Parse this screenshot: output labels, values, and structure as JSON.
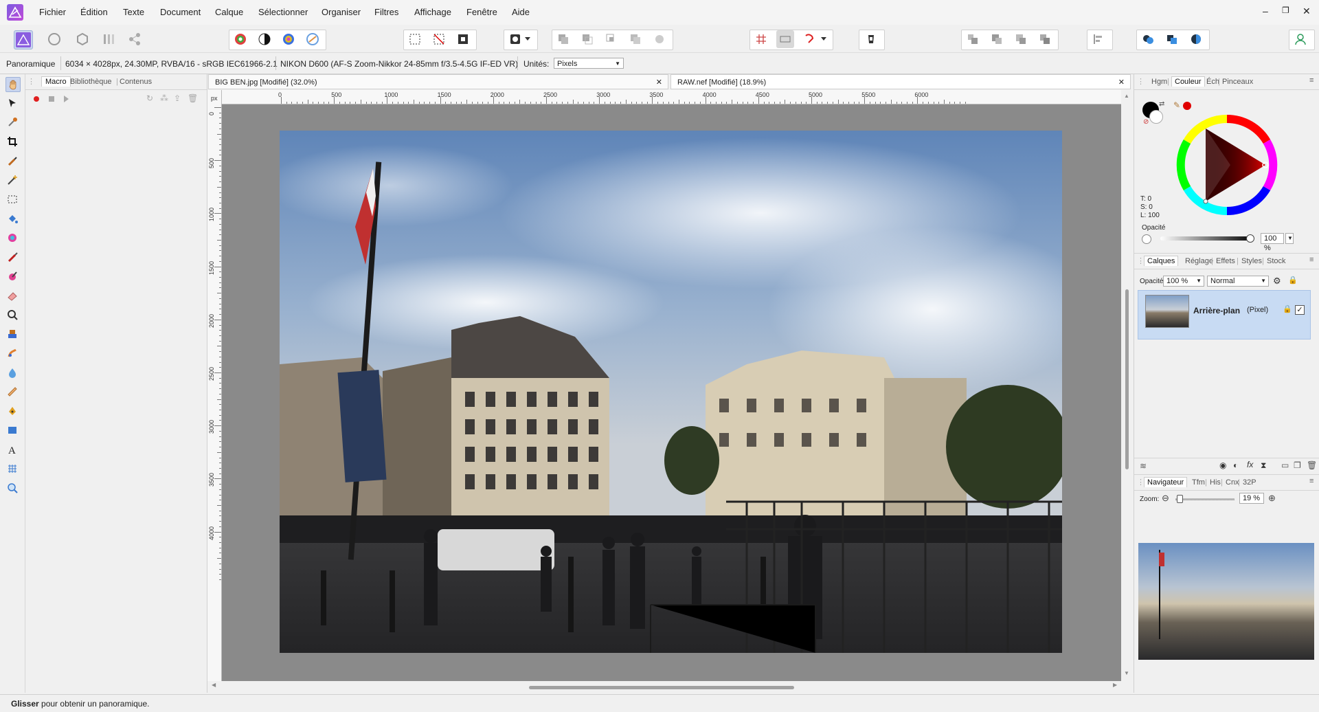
{
  "menubar": {
    "items": [
      "Fichier",
      "Édition",
      "Texte",
      "Document",
      "Calque",
      "Sélectionner",
      "Organiser",
      "Filtres",
      "Affichage",
      "Fenêtre",
      "Aide"
    ],
    "window_controls": [
      "–",
      "❐",
      "✕"
    ]
  },
  "contextbar": {
    "mode": "Panoramique",
    "image_info": "6034 × 4028px, 24.30MP, RVBA/16 - sRGB IEC61966-2.1",
    "camera_info": "NIKON D600 (AF-S Zoom-Nikkor 24-85mm f/3.5-4.5G IF-ED VR)",
    "units_label": "Unités:",
    "units_value": "Pixels"
  },
  "left_panel": {
    "tabs": [
      "Macro",
      "Bibliothèque",
      "Contenus"
    ],
    "active_tab": "Macro"
  },
  "documents": {
    "tabs": [
      {
        "label": "BIG BEN.jpg [Modifié] (32.0%)",
        "close": "✕"
      },
      {
        "label": "RAW.nef [Modifié] (18.9%)",
        "close": "✕"
      }
    ]
  },
  "rulers": {
    "unit": "px",
    "top_labels": [
      "0",
      "500",
      "1000",
      "1500",
      "2000",
      "2500",
      "3000",
      "3500",
      "4000",
      "4500",
      "5000",
      "5500",
      "6000"
    ],
    "left_labels": [
      "0",
      "500",
      "1000",
      "1500",
      "2000",
      "2500",
      "3000",
      "3500",
      "4000"
    ]
  },
  "color_panel": {
    "tabs": [
      "Hgm",
      "Couleur",
      "Éch",
      "Pinceaux"
    ],
    "active_tab": "Couleur",
    "t": "T: 0",
    "s": "S: 0",
    "l": "L: 100",
    "opacity_label": "Opacité",
    "opacity_value": "100 %",
    "primary_color": "#000000",
    "secondary_color": "#ffffff",
    "picker_dot": "#e00000"
  },
  "layers_panel": {
    "tabs": [
      "Calques",
      "Réglage",
      "Effets",
      "Styles",
      "Stock"
    ],
    "active_tab": "Calques",
    "opacity_label": "Opacité:",
    "opacity_value": "100 %",
    "blend_mode": "Normal",
    "layer_name": "Arrière-plan",
    "layer_type": "(Pixel)"
  },
  "navigator_panel": {
    "tabs": [
      "Navigateur",
      "Tfm",
      "His",
      "Cnx",
      "32P"
    ],
    "active_tab": "Navigateur",
    "zoom_label": "Zoom:",
    "zoom_value": "19 %"
  },
  "status": {
    "bold": "Glisser",
    "text": " pour obtenir un panoramique."
  }
}
